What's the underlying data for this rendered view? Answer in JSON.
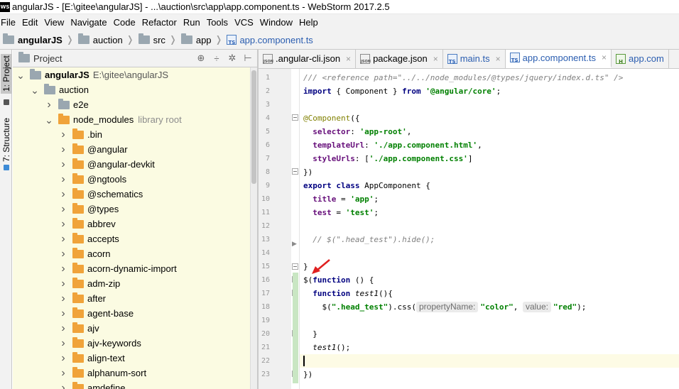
{
  "window": {
    "title": "angularJS - [E:\\gitee\\angularJS] - ...\\auction\\src\\app\\app.component.ts - WebStorm 2017.2.5",
    "logo_text": "WS"
  },
  "menu": [
    "File",
    "Edit",
    "View",
    "Navigate",
    "Code",
    "Refactor",
    "Run",
    "Tools",
    "VCS",
    "Window",
    "Help"
  ],
  "breadcrumb": [
    {
      "label": "angularJS",
      "bold": true
    },
    {
      "label": "auction"
    },
    {
      "label": "src"
    },
    {
      "label": "app"
    },
    {
      "label": "app.component.ts",
      "file": true
    }
  ],
  "tool_stripe": {
    "project_label": "1: Project",
    "structure_label": "7: Structure"
  },
  "project_panel": {
    "title": "Project",
    "icons": [
      "target-icon",
      "split-icon",
      "gear-icon",
      "collapse-icon"
    ],
    "tree": [
      {
        "label": "angularJS",
        "extra": "E:\\gitee\\angularJS",
        "level": 0,
        "expanded": true,
        "folder": "grey",
        "root": true
      },
      {
        "label": "auction",
        "level": 1,
        "expanded": true,
        "folder": "grey"
      },
      {
        "label": "e2e",
        "level": 2,
        "expanded": false,
        "folder": "grey"
      },
      {
        "label": "node_modules",
        "extra": "library root",
        "level": 2,
        "expanded": true,
        "folder": "orange"
      },
      {
        "label": ".bin",
        "level": 3,
        "expanded": false,
        "folder": "orange"
      },
      {
        "label": "@angular",
        "level": 3,
        "expanded": false,
        "folder": "orange"
      },
      {
        "label": "@angular-devkit",
        "level": 3,
        "expanded": false,
        "folder": "orange"
      },
      {
        "label": "@ngtools",
        "level": 3,
        "expanded": false,
        "folder": "orange"
      },
      {
        "label": "@schematics",
        "level": 3,
        "expanded": false,
        "folder": "orange"
      },
      {
        "label": "@types",
        "level": 3,
        "expanded": false,
        "folder": "orange"
      },
      {
        "label": "abbrev",
        "level": 3,
        "expanded": false,
        "folder": "orange"
      },
      {
        "label": "accepts",
        "level": 3,
        "expanded": false,
        "folder": "orange"
      },
      {
        "label": "acorn",
        "level": 3,
        "expanded": false,
        "folder": "orange"
      },
      {
        "label": "acorn-dynamic-import",
        "level": 3,
        "expanded": false,
        "folder": "orange"
      },
      {
        "label": "adm-zip",
        "level": 3,
        "expanded": false,
        "folder": "orange"
      },
      {
        "label": "after",
        "level": 3,
        "expanded": false,
        "folder": "orange"
      },
      {
        "label": "agent-base",
        "level": 3,
        "expanded": false,
        "folder": "orange"
      },
      {
        "label": "ajv",
        "level": 3,
        "expanded": false,
        "folder": "orange"
      },
      {
        "label": "ajv-keywords",
        "level": 3,
        "expanded": false,
        "folder": "orange"
      },
      {
        "label": "align-text",
        "level": 3,
        "expanded": false,
        "folder": "orange"
      },
      {
        "label": "alphanum-sort",
        "level": 3,
        "expanded": false,
        "folder": "orange"
      },
      {
        "label": "amdefine",
        "level": 3,
        "expanded": false,
        "folder": "orange"
      }
    ]
  },
  "tabs": [
    {
      "label": ".angular-cli.json",
      "icon": "json-icon",
      "close": "×"
    },
    {
      "label": "package.json",
      "icon": "json-icon",
      "close": "×"
    },
    {
      "label": "main.ts",
      "icon": "ts-icon",
      "close": "×",
      "blue": true
    },
    {
      "label": "app.component.ts",
      "icon": "ts-icon",
      "close": "×",
      "blue": true,
      "active": true
    },
    {
      "label": "app.com",
      "icon": "h-icon",
      "blue": true
    }
  ],
  "editor": {
    "current_line": 22,
    "lines": [
      {
        "n": "1",
        "tokens": [
          {
            "t": "/// <reference path=\"../../node_modules/@types/jquery/index.d.ts\" />",
            "c": "cmt"
          }
        ]
      },
      {
        "n": "2",
        "tokens": [
          {
            "t": "import",
            "c": "kw"
          },
          {
            "t": " { Component } ",
            "c": ""
          },
          {
            "t": "from",
            "c": "kw"
          },
          {
            "t": " ",
            "c": ""
          },
          {
            "t": "'@angular/core'",
            "c": "str"
          },
          {
            "t": ";",
            "c": ""
          }
        ]
      },
      {
        "n": "3",
        "tokens": []
      },
      {
        "n": "4",
        "tokens": [
          {
            "t": "@Component",
            "c": "dec"
          },
          {
            "t": "({",
            "c": ""
          }
        ]
      },
      {
        "n": "5",
        "tokens": [
          {
            "t": "  ",
            "c": ""
          },
          {
            "t": "selector",
            "c": "prop"
          },
          {
            "t": ": ",
            "c": ""
          },
          {
            "t": "'app-root'",
            "c": "str"
          },
          {
            "t": ",",
            "c": ""
          }
        ]
      },
      {
        "n": "6",
        "tokens": [
          {
            "t": "  ",
            "c": ""
          },
          {
            "t": "templateUrl",
            "c": "prop"
          },
          {
            "t": ": ",
            "c": ""
          },
          {
            "t": "'./app.component.html'",
            "c": "str"
          },
          {
            "t": ",",
            "c": ""
          }
        ]
      },
      {
        "n": "7",
        "tokens": [
          {
            "t": "  ",
            "c": ""
          },
          {
            "t": "styleUrls",
            "c": "prop"
          },
          {
            "t": ": [",
            "c": ""
          },
          {
            "t": "'./app.component.css'",
            "c": "str"
          },
          {
            "t": "]",
            "c": ""
          }
        ]
      },
      {
        "n": "8",
        "tokens": [
          {
            "t": "})",
            "c": ""
          }
        ]
      },
      {
        "n": "9",
        "tokens": [
          {
            "t": "export",
            "c": "kw"
          },
          {
            "t": " ",
            "c": ""
          },
          {
            "t": "class",
            "c": "kw"
          },
          {
            "t": " AppComponent {",
            "c": ""
          }
        ]
      },
      {
        "n": "10",
        "tokens": [
          {
            "t": "  ",
            "c": ""
          },
          {
            "t": "title",
            "c": "prop"
          },
          {
            "t": " = ",
            "c": ""
          },
          {
            "t": "'app'",
            "c": "str"
          },
          {
            "t": ";",
            "c": ""
          }
        ]
      },
      {
        "n": "11",
        "tokens": [
          {
            "t": "  ",
            "c": ""
          },
          {
            "t": "test",
            "c": "prop"
          },
          {
            "t": " = ",
            "c": ""
          },
          {
            "t": "'test'",
            "c": "str"
          },
          {
            "t": ";",
            "c": ""
          }
        ]
      },
      {
        "n": "12",
        "tokens": []
      },
      {
        "n": "13",
        "tokens": [
          {
            "t": "  // $(\".head_test\").hide();",
            "c": "cmt"
          }
        ]
      },
      {
        "n": "14",
        "tokens": []
      },
      {
        "n": "15",
        "tokens": [
          {
            "t": "}",
            "c": ""
          }
        ]
      },
      {
        "n": "16",
        "tokens": [
          {
            "t": "$(",
            "c": ""
          },
          {
            "t": "function",
            "c": "kw"
          },
          {
            "t": " () {",
            "c": ""
          }
        ]
      },
      {
        "n": "17",
        "tokens": [
          {
            "t": "  ",
            "c": ""
          },
          {
            "t": "function",
            "c": "kw"
          },
          {
            "t": " ",
            "c": ""
          },
          {
            "t": "test1",
            "c": "fn"
          },
          {
            "t": "(){",
            "c": ""
          }
        ]
      },
      {
        "n": "18",
        "tokens": [
          {
            "t": "    $(",
            "c": ""
          },
          {
            "t": "\".head_test\"",
            "c": "str"
          },
          {
            "t": ").css(",
            "c": ""
          },
          {
            "t": "propertyName:",
            "c": "hint"
          },
          {
            "t": "\"color\"",
            "c": "str"
          },
          {
            "t": ", ",
            "c": ""
          },
          {
            "t": "value:",
            "c": "hint"
          },
          {
            "t": "\"red\"",
            "c": "str"
          },
          {
            "t": ");",
            "c": ""
          }
        ]
      },
      {
        "n": "19",
        "tokens": []
      },
      {
        "n": "20",
        "tokens": [
          {
            "t": "  }",
            "c": ""
          }
        ]
      },
      {
        "n": "21",
        "tokens": [
          {
            "t": "  ",
            "c": ""
          },
          {
            "t": "test1",
            "c": "fn"
          },
          {
            "t": "();",
            "c": ""
          }
        ]
      },
      {
        "n": "22",
        "tokens": []
      },
      {
        "n": "23",
        "tokens": [
          {
            "t": "})",
            "c": ""
          }
        ]
      }
    ]
  }
}
